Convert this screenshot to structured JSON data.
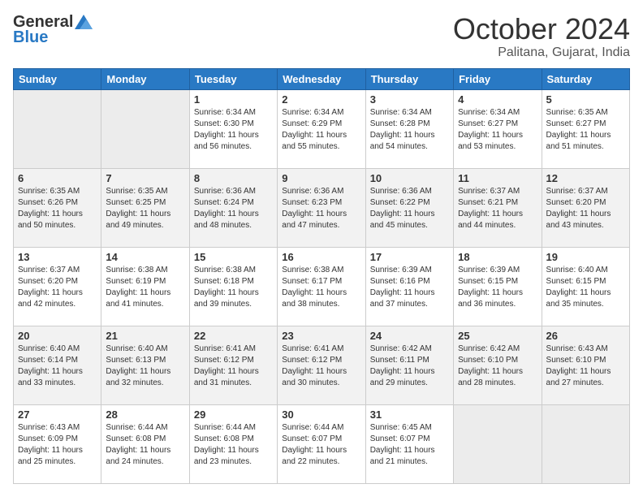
{
  "header": {
    "logo_general": "General",
    "logo_blue": "Blue",
    "month_title": "October 2024",
    "location": "Palitana, Gujarat, India"
  },
  "days_of_week": [
    "Sunday",
    "Monday",
    "Tuesday",
    "Wednesday",
    "Thursday",
    "Friday",
    "Saturday"
  ],
  "weeks": [
    [
      {
        "day": "",
        "empty": true
      },
      {
        "day": "",
        "empty": true
      },
      {
        "day": "1",
        "sunrise": "Sunrise: 6:34 AM",
        "sunset": "Sunset: 6:30 PM",
        "daylight": "Daylight: 11 hours and 56 minutes."
      },
      {
        "day": "2",
        "sunrise": "Sunrise: 6:34 AM",
        "sunset": "Sunset: 6:29 PM",
        "daylight": "Daylight: 11 hours and 55 minutes."
      },
      {
        "day": "3",
        "sunrise": "Sunrise: 6:34 AM",
        "sunset": "Sunset: 6:28 PM",
        "daylight": "Daylight: 11 hours and 54 minutes."
      },
      {
        "day": "4",
        "sunrise": "Sunrise: 6:34 AM",
        "sunset": "Sunset: 6:27 PM",
        "daylight": "Daylight: 11 hours and 53 minutes."
      },
      {
        "day": "5",
        "sunrise": "Sunrise: 6:35 AM",
        "sunset": "Sunset: 6:27 PM",
        "daylight": "Daylight: 11 hours and 51 minutes."
      }
    ],
    [
      {
        "day": "6",
        "sunrise": "Sunrise: 6:35 AM",
        "sunset": "Sunset: 6:26 PM",
        "daylight": "Daylight: 11 hours and 50 minutes."
      },
      {
        "day": "7",
        "sunrise": "Sunrise: 6:35 AM",
        "sunset": "Sunset: 6:25 PM",
        "daylight": "Daylight: 11 hours and 49 minutes."
      },
      {
        "day": "8",
        "sunrise": "Sunrise: 6:36 AM",
        "sunset": "Sunset: 6:24 PM",
        "daylight": "Daylight: 11 hours and 48 minutes."
      },
      {
        "day": "9",
        "sunrise": "Sunrise: 6:36 AM",
        "sunset": "Sunset: 6:23 PM",
        "daylight": "Daylight: 11 hours and 47 minutes."
      },
      {
        "day": "10",
        "sunrise": "Sunrise: 6:36 AM",
        "sunset": "Sunset: 6:22 PM",
        "daylight": "Daylight: 11 hours and 45 minutes."
      },
      {
        "day": "11",
        "sunrise": "Sunrise: 6:37 AM",
        "sunset": "Sunset: 6:21 PM",
        "daylight": "Daylight: 11 hours and 44 minutes."
      },
      {
        "day": "12",
        "sunrise": "Sunrise: 6:37 AM",
        "sunset": "Sunset: 6:20 PM",
        "daylight": "Daylight: 11 hours and 43 minutes."
      }
    ],
    [
      {
        "day": "13",
        "sunrise": "Sunrise: 6:37 AM",
        "sunset": "Sunset: 6:20 PM",
        "daylight": "Daylight: 11 hours and 42 minutes."
      },
      {
        "day": "14",
        "sunrise": "Sunrise: 6:38 AM",
        "sunset": "Sunset: 6:19 PM",
        "daylight": "Daylight: 11 hours and 41 minutes."
      },
      {
        "day": "15",
        "sunrise": "Sunrise: 6:38 AM",
        "sunset": "Sunset: 6:18 PM",
        "daylight": "Daylight: 11 hours and 39 minutes."
      },
      {
        "day": "16",
        "sunrise": "Sunrise: 6:38 AM",
        "sunset": "Sunset: 6:17 PM",
        "daylight": "Daylight: 11 hours and 38 minutes."
      },
      {
        "day": "17",
        "sunrise": "Sunrise: 6:39 AM",
        "sunset": "Sunset: 6:16 PM",
        "daylight": "Daylight: 11 hours and 37 minutes."
      },
      {
        "day": "18",
        "sunrise": "Sunrise: 6:39 AM",
        "sunset": "Sunset: 6:15 PM",
        "daylight": "Daylight: 11 hours and 36 minutes."
      },
      {
        "day": "19",
        "sunrise": "Sunrise: 6:40 AM",
        "sunset": "Sunset: 6:15 PM",
        "daylight": "Daylight: 11 hours and 35 minutes."
      }
    ],
    [
      {
        "day": "20",
        "sunrise": "Sunrise: 6:40 AM",
        "sunset": "Sunset: 6:14 PM",
        "daylight": "Daylight: 11 hours and 33 minutes."
      },
      {
        "day": "21",
        "sunrise": "Sunrise: 6:40 AM",
        "sunset": "Sunset: 6:13 PM",
        "daylight": "Daylight: 11 hours and 32 minutes."
      },
      {
        "day": "22",
        "sunrise": "Sunrise: 6:41 AM",
        "sunset": "Sunset: 6:12 PM",
        "daylight": "Daylight: 11 hours and 31 minutes."
      },
      {
        "day": "23",
        "sunrise": "Sunrise: 6:41 AM",
        "sunset": "Sunset: 6:12 PM",
        "daylight": "Daylight: 11 hours and 30 minutes."
      },
      {
        "day": "24",
        "sunrise": "Sunrise: 6:42 AM",
        "sunset": "Sunset: 6:11 PM",
        "daylight": "Daylight: 11 hours and 29 minutes."
      },
      {
        "day": "25",
        "sunrise": "Sunrise: 6:42 AM",
        "sunset": "Sunset: 6:10 PM",
        "daylight": "Daylight: 11 hours and 28 minutes."
      },
      {
        "day": "26",
        "sunrise": "Sunrise: 6:43 AM",
        "sunset": "Sunset: 6:10 PM",
        "daylight": "Daylight: 11 hours and 27 minutes."
      }
    ],
    [
      {
        "day": "27",
        "sunrise": "Sunrise: 6:43 AM",
        "sunset": "Sunset: 6:09 PM",
        "daylight": "Daylight: 11 hours and 25 minutes."
      },
      {
        "day": "28",
        "sunrise": "Sunrise: 6:44 AM",
        "sunset": "Sunset: 6:08 PM",
        "daylight": "Daylight: 11 hours and 24 minutes."
      },
      {
        "day": "29",
        "sunrise": "Sunrise: 6:44 AM",
        "sunset": "Sunset: 6:08 PM",
        "daylight": "Daylight: 11 hours and 23 minutes."
      },
      {
        "day": "30",
        "sunrise": "Sunrise: 6:44 AM",
        "sunset": "Sunset: 6:07 PM",
        "daylight": "Daylight: 11 hours and 22 minutes."
      },
      {
        "day": "31",
        "sunrise": "Sunrise: 6:45 AM",
        "sunset": "Sunset: 6:07 PM",
        "daylight": "Daylight: 11 hours and 21 minutes."
      },
      {
        "day": "",
        "empty": true
      },
      {
        "day": "",
        "empty": true
      }
    ]
  ]
}
